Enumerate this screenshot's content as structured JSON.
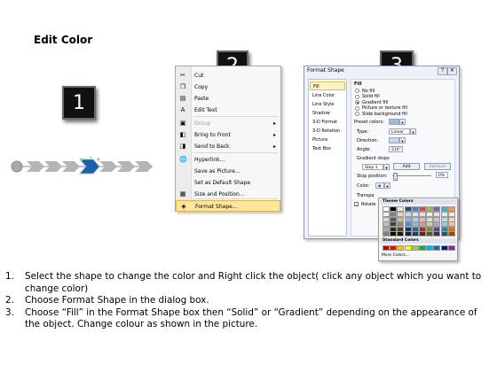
{
  "heading": "Edit Color",
  "step_boxes": [
    "1",
    "2",
    "3"
  ],
  "context_menu": {
    "items": [
      {
        "label": "Cut",
        "icon": "scissors-icon",
        "glyph": "✂",
        "submenu": false,
        "disabled": false
      },
      {
        "label": "Copy",
        "icon": "copy-icon",
        "glyph": "❐",
        "submenu": false,
        "disabled": false
      },
      {
        "label": "Paste",
        "icon": "paste-icon",
        "glyph": "▤",
        "submenu": false,
        "disabled": false
      },
      {
        "label": "Edit Text",
        "icon": "edit-text-icon",
        "glyph": "A",
        "submenu": false,
        "disabled": false
      },
      {
        "label": "Group",
        "icon": "group-icon",
        "glyph": "▣",
        "submenu": true,
        "disabled": true
      },
      {
        "label": "Bring to Front",
        "icon": "bring-to-front-icon",
        "glyph": "◧",
        "submenu": true,
        "disabled": false
      },
      {
        "label": "Send to Back",
        "icon": "send-to-back-icon",
        "glyph": "◨",
        "submenu": true,
        "disabled": false
      },
      {
        "label": "Hyperlink...",
        "icon": "hyperlink-icon",
        "glyph": "🌐",
        "submenu": false,
        "disabled": false
      },
      {
        "label": "Save as Picture...",
        "icon": "",
        "glyph": "",
        "submenu": false,
        "disabled": false
      },
      {
        "label": "Set as Default Shape",
        "icon": "",
        "glyph": "",
        "submenu": false,
        "disabled": false
      },
      {
        "label": "Size and Position...",
        "icon": "size-position-icon",
        "glyph": "▦",
        "submenu": false,
        "disabled": false
      },
      {
        "label": "Format Shape...",
        "icon": "format-shape-icon",
        "glyph": "◈",
        "submenu": false,
        "disabled": false,
        "highlighted": true
      }
    ]
  },
  "dialog": {
    "title": "Format Shape",
    "close_glyph": "✕",
    "help_glyph": "?",
    "nav": [
      "Fill",
      "Line Color",
      "Line Style",
      "Shadow",
      "3-D Format",
      "3-D Rotation",
      "Picture",
      "Text Box"
    ],
    "fill_section": "Fill",
    "fill_options": [
      "No fill",
      "Solid fill",
      "Gradient fill",
      "Picture or texture fill",
      "Slide background fill"
    ],
    "selected_fill": 2,
    "preset_colors_label": "Preset colors:",
    "type_label": "Type:",
    "type_value": "Linear",
    "direction_label": "Direction:",
    "angle_label": "Angle:",
    "angle_value": "210°",
    "gradient_stops_label": "Gradient stops",
    "stop_value": "Stop 1",
    "add_label": "Add",
    "remove_label": "Remove",
    "stop_position_label": "Stop position:",
    "stop_position_value": "0%",
    "color_label": "Color:",
    "transparency_label": "Transpa",
    "rotate_label": "Rotate"
  },
  "palette": {
    "theme_title": "Theme Colors",
    "standard_title": "Standard Colors",
    "more_label": "More Colors...",
    "theme_top": [
      "#ffffff",
      "#000000",
      "#eeece1",
      "#1f497d",
      "#4f81bd",
      "#c0504d",
      "#9bbb59",
      "#8064a2",
      "#4bacc6",
      "#f79646"
    ],
    "theme_shades": [
      [
        "#f2f2f2",
        "#7f7f7f",
        "#ddd9c3",
        "#c6d9f0",
        "#dbe5f1",
        "#f2dcdb",
        "#ebf1dd",
        "#e5e0ec",
        "#dbeef3",
        "#fdeada"
      ],
      [
        "#d8d8d8",
        "#595959",
        "#c4bd97",
        "#8db3e2",
        "#b8cce4",
        "#e5b9b7",
        "#d7e3bc",
        "#ccc1d9",
        "#b7dde8",
        "#fbd5b5"
      ],
      [
        "#bfbfbf",
        "#3f3f3f",
        "#938953",
        "#548dd4",
        "#95b3d7",
        "#d99694",
        "#c3d69b",
        "#b2a2c7",
        "#92cddc",
        "#fac08f"
      ],
      [
        "#a5a5a5",
        "#262626",
        "#494429",
        "#17365d",
        "#366092",
        "#953734",
        "#76923c",
        "#5f497a",
        "#31859b",
        "#e36c09"
      ],
      [
        "#7f7f7f",
        "#0c0c0c",
        "#1d1b10",
        "#0f243e",
        "#244061",
        "#632423",
        "#4f6128",
        "#3f3151",
        "#205867",
        "#974806"
      ]
    ],
    "standard": [
      "#c00000",
      "#ff0000",
      "#ffc000",
      "#ffff00",
      "#92d050",
      "#00b050",
      "#00b0f0",
      "#0070c0",
      "#002060",
      "#7030a0"
    ]
  },
  "instructions": [
    {
      "num": "1.",
      "text": "Select the shape to change the color and Right click the object( click any object which you want to change color)"
    },
    {
      "num": "2.",
      "text": "Choose Format Shape in the dialog box."
    },
    {
      "num": "3.",
      "text": "Choose “Fill” in the Format Shape box then “Solid” or “Gradient” depending on the appearance of the object. Change colour as shown in the picture."
    }
  ],
  "colors": {
    "arrow_gray": "#b5b5b5",
    "arrow_selected": "#1f5fa8",
    "menu_highlight": "#fbe6a0",
    "dialog_bg": "#eef2f8"
  }
}
